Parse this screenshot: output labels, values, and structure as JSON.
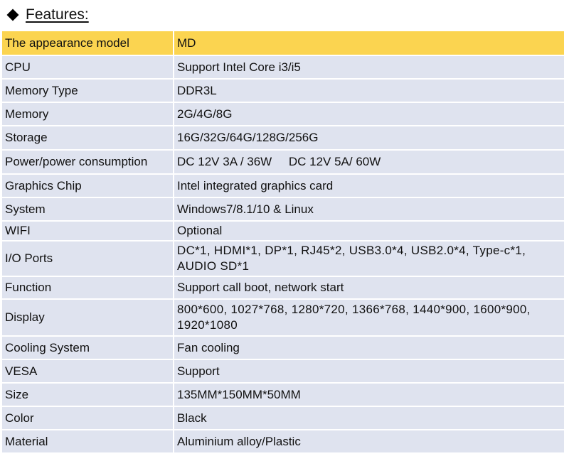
{
  "heading": {
    "title": "Features:",
    "bullet_icon": "diamond-bullet-icon"
  },
  "colors": {
    "header_row": "#fbd450",
    "body_row": "#dfe3ef",
    "divider": "#ffffff"
  },
  "table": {
    "header": {
      "label": "The appearance model",
      "value": "MD"
    },
    "rows": [
      {
        "label": "CPU",
        "value": "Support Intel Core i3/i5"
      },
      {
        "label": "Memory Type",
        "value": "DDR3L"
      },
      {
        "label": "Memory",
        "value": "2G/4G/8G"
      },
      {
        "label": "Storage",
        "value": "16G/32G/64G/128G/256G"
      },
      {
        "label": "Power/power consumption",
        "value": "DC 12V 3A / 36W     DC 12V 5A/ 60W"
      },
      {
        "label": "Graphics Chip",
        "value": "Intel integrated graphics card"
      },
      {
        "label": "System",
        "value": "Windows7/8.1/10 & Linux"
      },
      {
        "label": "WIFI",
        "value": "Optional"
      },
      {
        "label": "I/O Ports",
        "value": "DC*1, HDMI*1, DP*1, RJ45*2, USB3.0*4, USB2.0*4, Type-c*1, AUDIO SD*1"
      },
      {
        "label": "Function",
        "value": "Support call boot, network start"
      },
      {
        "label": "Display",
        "value": "800*600, 1027*768, 1280*720, 1366*768, 1440*900, 1600*900, 1920*1080"
      },
      {
        "label": "Cooling System",
        "value": "Fan cooling"
      },
      {
        "label": "VESA",
        "value": "Support"
      },
      {
        "label": "Size",
        "value": "135MM*150MM*50MM"
      },
      {
        "label": "Color",
        "value": "Black"
      },
      {
        "label": "Material",
        "value": "Aluminium alloy/Plastic"
      }
    ]
  }
}
